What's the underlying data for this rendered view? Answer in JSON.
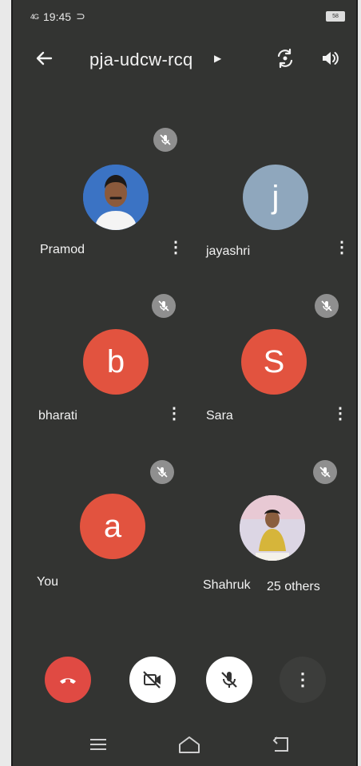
{
  "status_bar": {
    "signal": "4G",
    "time": "19:45",
    "battery": "58"
  },
  "header": {
    "meeting_code": "pja-udcw-rcq"
  },
  "participants": [
    {
      "name": "Pramod",
      "avatar_letter": "",
      "avatar_color": "#3b73c4",
      "muted": true,
      "has_photo": true
    },
    {
      "name": "jayashri",
      "avatar_letter": "j",
      "avatar_color": "#8fa7bd",
      "muted": true,
      "has_photo": false
    },
    {
      "name": "bharati",
      "avatar_letter": "b",
      "avatar_color": "#e2533f",
      "muted": true,
      "has_photo": false
    },
    {
      "name": "Sara",
      "avatar_letter": "S",
      "avatar_color": "#e2533f",
      "muted": true,
      "has_photo": false
    },
    {
      "name": "You",
      "avatar_letter": "a",
      "avatar_color": "#e2533f",
      "muted": true,
      "has_photo": false
    },
    {
      "name": "Shahruk",
      "avatar_letter": "",
      "avatar_color": "#d7cfe0",
      "muted": true,
      "has_photo": true,
      "others_label": "25 others"
    }
  ],
  "controls": {
    "end_call_color": "#e04a43",
    "button_color": "#ffffff",
    "more_color": "#3c3d3b"
  }
}
